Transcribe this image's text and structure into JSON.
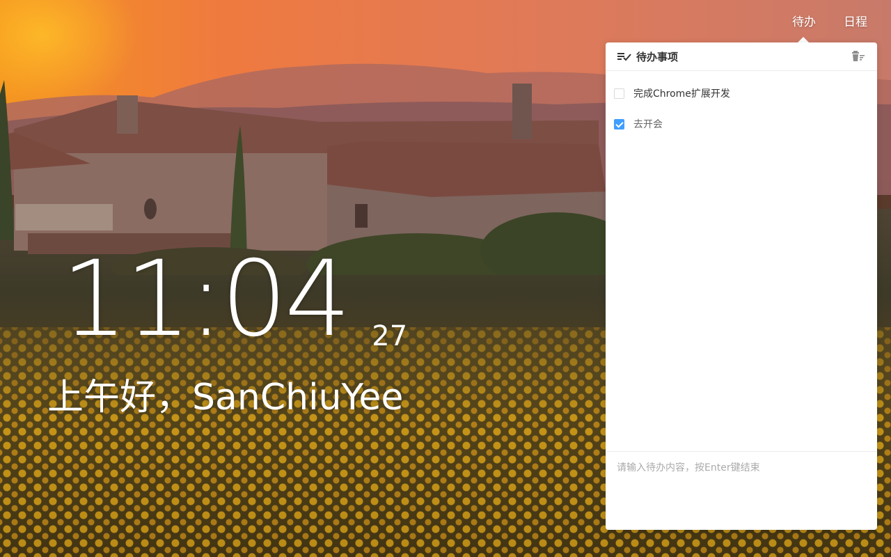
{
  "clock": {
    "time": "11:04",
    "seconds": "27"
  },
  "greeting": "上午好，SanChiuYee",
  "nav": {
    "todo": "待办",
    "schedule": "日程"
  },
  "panel": {
    "title": "待办事项",
    "items": [
      {
        "text": "完成Chrome扩展开发",
        "checked": false
      },
      {
        "text": "去开会",
        "checked": true
      }
    ],
    "input_placeholder": "请输入待办内容，按Enter键结束"
  },
  "colors": {
    "accent": "#409eff",
    "sky": "#ef7a3f"
  },
  "icons": {
    "title": "list-check-icon",
    "clear": "trash-clear-icon"
  }
}
